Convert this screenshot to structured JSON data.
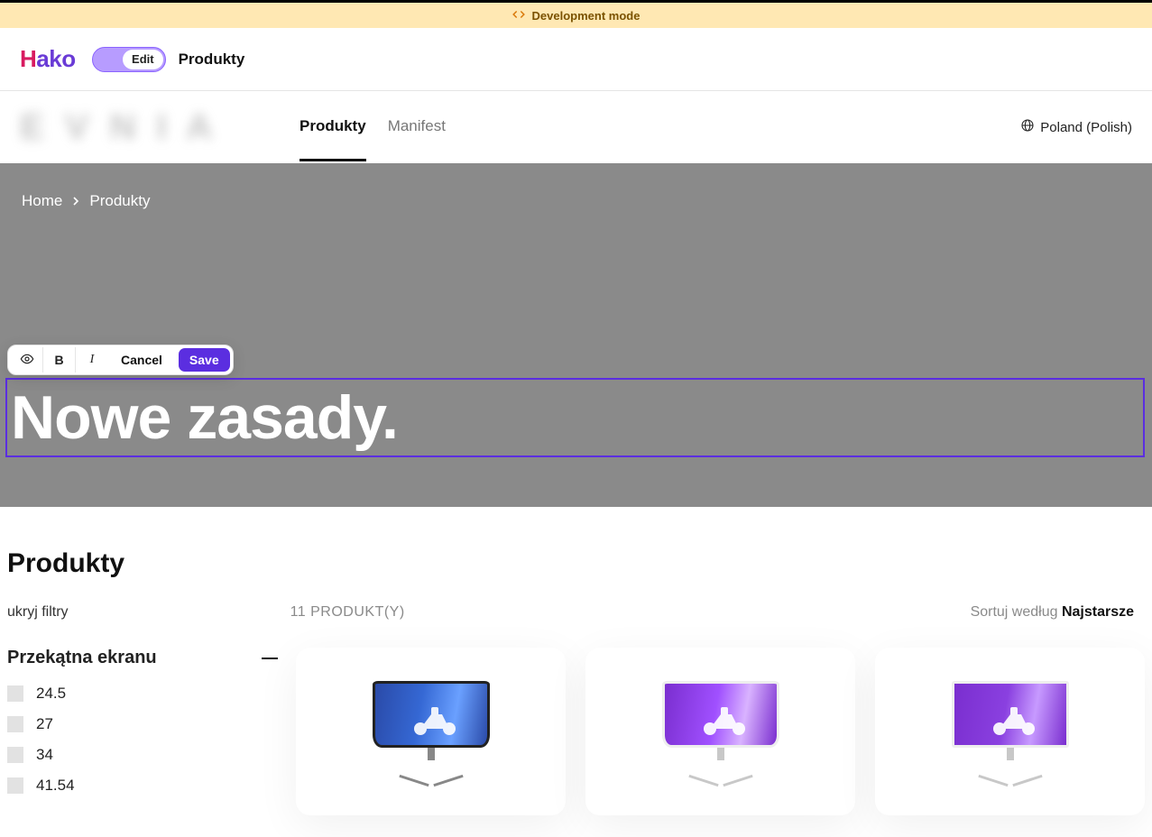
{
  "devBanner": {
    "label": "Development mode"
  },
  "appBar": {
    "logoH": "H",
    "logoAko": "ako",
    "toggleLabel": "Edit",
    "pageLabel": "Produkty"
  },
  "siteNav": {
    "brandPlaceholder": "E V N I A",
    "tabs": [
      {
        "label": "Produkty",
        "active": true
      },
      {
        "label": "Manifest",
        "active": false
      }
    ],
    "locale": "Poland (Polish)"
  },
  "breadcrumb": {
    "home": "Home",
    "current": "Produkty"
  },
  "editor": {
    "cancel": "Cancel",
    "save": "Save"
  },
  "hero": {
    "title": "Nowe zasady."
  },
  "section": {
    "title": "Produkty",
    "hideFilters": "ukryj filtry",
    "count": "11 PRODUKT(Y)",
    "sortLabel": "Sortuj według ",
    "sortValue": "Najstarsze"
  },
  "filters": {
    "groupTitle": "Przekątna ekranu",
    "options": [
      "24.5",
      "27",
      "34",
      "41.54"
    ]
  }
}
